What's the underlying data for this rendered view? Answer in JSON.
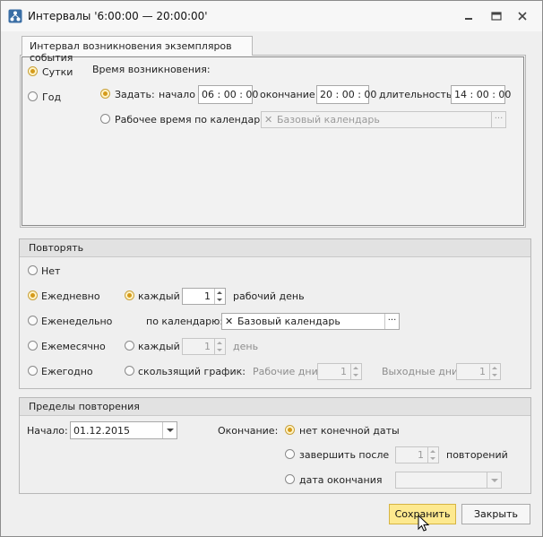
{
  "window": {
    "title": "Интервалы '6:00:00 — 20:00:00'",
    "icon": "hierarchy-icon"
  },
  "tab": {
    "label": "Интервал возникновения экземпляров события"
  },
  "period": {
    "day_label": "Сутки",
    "year_label": "Год",
    "selected": "Сутки"
  },
  "occurrence": {
    "heading": "Время возникновения:",
    "set_label": "Задать:",
    "start_label": "начало",
    "start_value": "06 : 00 : 00",
    "end_label": "окончание",
    "end_value": "20 : 00 : 00",
    "duration_label": "длительность",
    "duration_value": "14 : 00 : 00",
    "workcal_label": "Рабочее время по календарю:",
    "workcal_value": "Базовый календарь"
  },
  "repeat": {
    "title": "Повторять",
    "none_label": "Нет",
    "daily_label": "Ежедневно",
    "weekly_label": "Еженедельно",
    "monthly_label": "Ежемесячно",
    "yearly_label": "Ежегодно",
    "selected": "Ежедневно",
    "every_label": "каждый",
    "every_value": "1",
    "workday_label": "рабочий день",
    "by_calendar_label": "по календарю:",
    "calendar_value": "Базовый календарь",
    "every2_label": "каждый",
    "every2_value": "1",
    "day_label": "день",
    "sliding_label": "скользящий график:",
    "workdays_label": "Рабочие дни:",
    "workdays_value": "1",
    "daysoff_label": "Выходные дни:",
    "daysoff_value": "1"
  },
  "limits": {
    "title": "Пределы повторения",
    "start_label": "Начало:",
    "start_value": "01.12.2015",
    "end_label": "Окончание:",
    "no_end_label": "нет конечной даты",
    "end_after_label": "завершить после",
    "end_after_value": "1",
    "repeats_label": "повторений",
    "end_date_label": "дата окончания"
  },
  "buttons": {
    "save": "Сохранить",
    "close": "Закрыть"
  },
  "colors": {
    "accent": "#d59a1a",
    "hot_button": "#fde98f"
  }
}
